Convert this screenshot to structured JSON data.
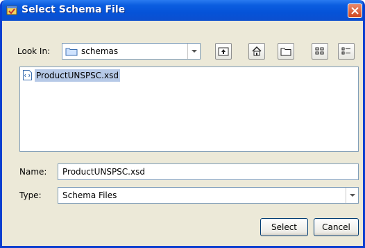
{
  "window": {
    "title": "Select Schema File"
  },
  "look_in": {
    "label": "Look In:",
    "value": "schemas"
  },
  "toolbar": {
    "up_icon": "up-folder-icon",
    "home_icon": "home-icon",
    "new_folder_icon": "new-folder-icon",
    "list_view_icon": "list-view-icon",
    "details_view_icon": "details-view-icon"
  },
  "files": [
    {
      "name": "ProductUNSPSC.xsd",
      "icon": "xsd-file-icon",
      "selected": true
    }
  ],
  "name_field": {
    "label": "Name:",
    "value": "ProductUNSPSC.xsd"
  },
  "type_field": {
    "label": "Type:",
    "value": "Schema Files"
  },
  "buttons": {
    "select": "Select",
    "cancel": "Cancel"
  },
  "colors": {
    "titlebar": "#0553d8",
    "selection": "#b6c9e7",
    "dialog_bg": "#ece9d8",
    "close": "#d0451e"
  }
}
